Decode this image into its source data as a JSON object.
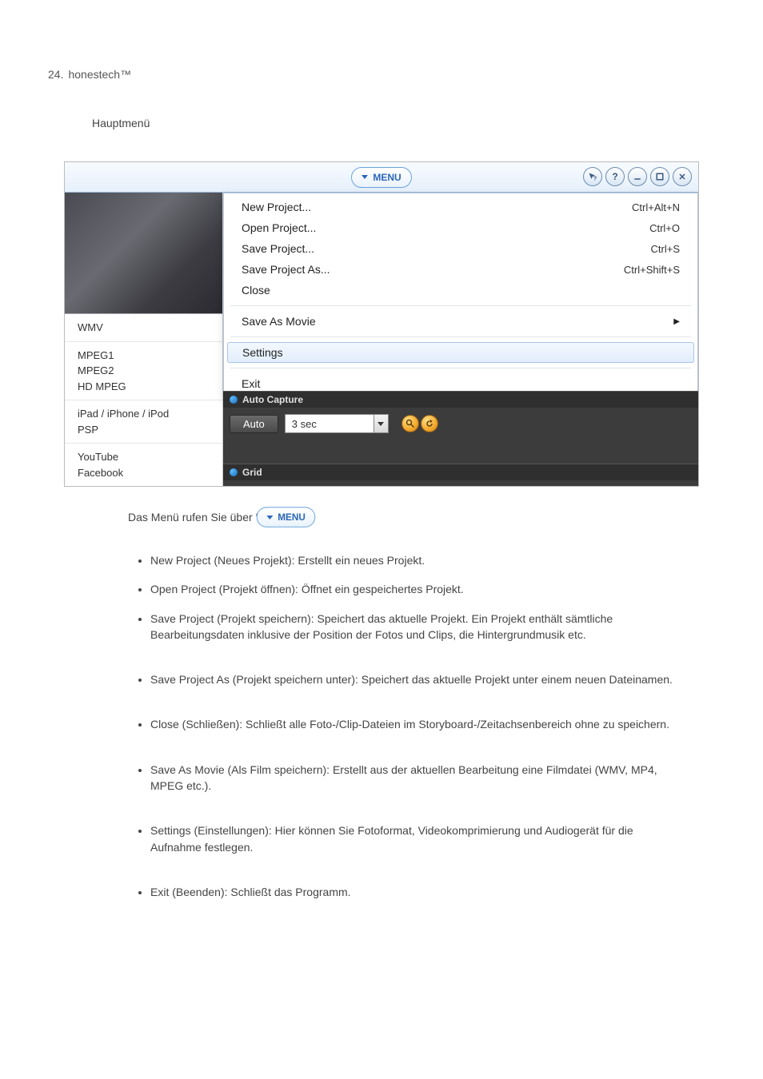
{
  "page_number": "24.",
  "brand": "honestech™",
  "lead": "Hauptmenü",
  "titlebar": {
    "menu_label": "MENU"
  },
  "winbtns": {
    "context_help": "context-help",
    "help": "?",
    "minimize": "minimize",
    "maximize": "maximize",
    "close": "×"
  },
  "sidebar": {
    "group1": [
      "WMV"
    ],
    "group2": [
      "MPEG1",
      "MPEG2",
      "HD MPEG"
    ],
    "group3": [
      "iPad / iPhone / iPod",
      "PSP"
    ],
    "group4": [
      "YouTube",
      "Facebook"
    ]
  },
  "menu": {
    "section1": [
      {
        "label": "New Project...",
        "shortcut": "Ctrl+Alt+N"
      },
      {
        "label": "Open Project...",
        "shortcut": "Ctrl+O"
      },
      {
        "label": "Save Project...",
        "shortcut": "Ctrl+S"
      },
      {
        "label": "Save Project As...",
        "shortcut": "Ctrl+Shift+S"
      },
      {
        "label": "Close",
        "shortcut": ""
      }
    ],
    "save_as_movie": "Save As Movie",
    "settings": "Settings",
    "exit": "Exit"
  },
  "panels": {
    "auto_capture_title": "Auto Capture",
    "auto_btn": "Auto",
    "interval": "3 sec",
    "grid_title": "Grid"
  },
  "expl": {
    "line": "Das Menü rufen Sie über ‘                          ’ auf.",
    "bullets": [
      {
        "t": "New Project (Neues Projekt): Erstellt ein neues Projekt."
      },
      {
        "t": "Open Project (Projekt öffnen): Öffnet ein gespeichertes Projekt."
      },
      {
        "t": "Save Project (Projekt speichern): Speichert das aktuelle Projekt. Ein Projekt enthält sämtliche Bearbeitungsdaten inklusive der Position der Fotos und Clips, die Hintergrundmusik etc.",
        "tall": true
      },
      {
        "t": "Save Project As (Projekt speichern unter): Speichert das aktuelle Projekt unter einem neuen Dateinamen.",
        "tall": true
      },
      {
        "t": "Close (Schließen): Schließt alle Foto-/Clip-Dateien im Storyboard-/Zeitachsenbereich ohne zu speichern.",
        "tall": true
      },
      {
        "t": "Save As Movie (Als Film speichern): Erstellt aus der aktuellen Bearbeitung eine Filmdatei (WMV, MP4, MPEG etc.).",
        "tall": true
      },
      {
        "t": "Settings (Einstellungen): Hier können Sie Fotoformat, Videokomprimierung und Audiogerät für die Aufnahme festlegen.",
        "tall": true
      },
      {
        "t": "Exit (Beenden): Schließt das Programm."
      }
    ]
  }
}
